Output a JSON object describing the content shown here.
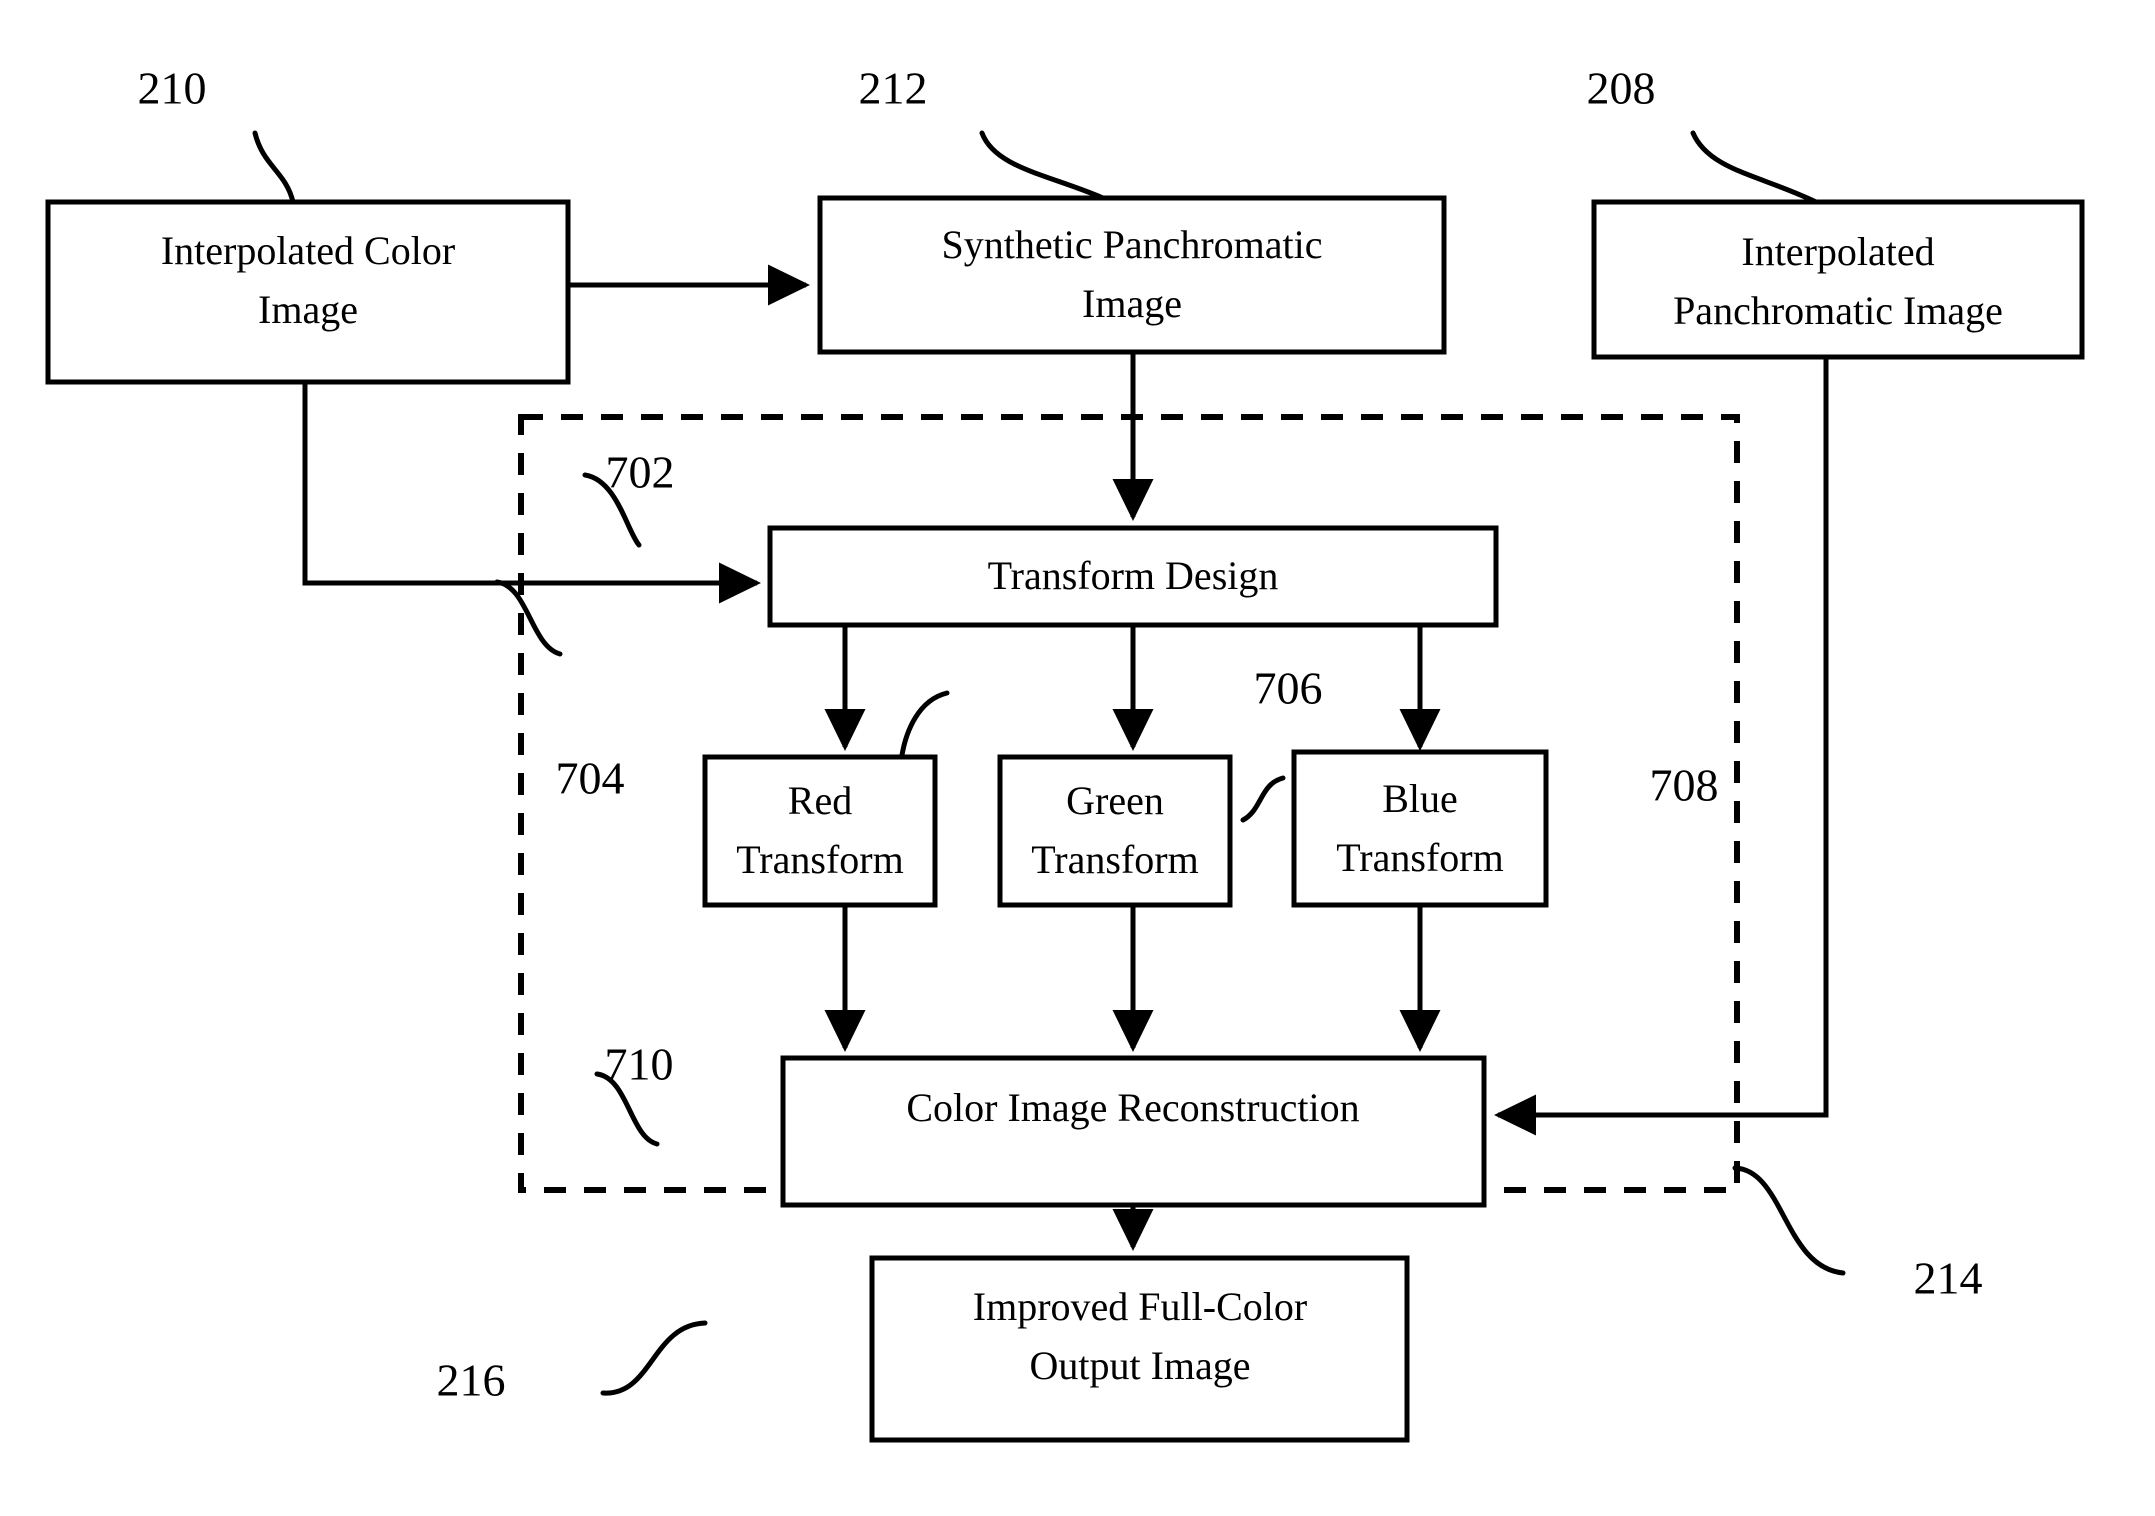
{
  "figure": {
    "type": "patent-block-diagram",
    "background_color": "#ffffff",
    "stroke_color": "#000000"
  },
  "nodes": {
    "interpolated_color_image": {
      "line1": "Interpolated Color",
      "line2": "Image",
      "ref": "210"
    },
    "synthetic_panchromatic_image": {
      "line1": "Synthetic Panchromatic",
      "line2": "Image",
      "ref": "212"
    },
    "interpolated_panchromatic_image": {
      "line1": "Interpolated",
      "line2": "Panchromatic Image",
      "ref": "208"
    },
    "transform_design": {
      "line1": "Transform Design",
      "ref": "702"
    },
    "red_transform": {
      "line1": "Red",
      "line2": "Transform",
      "ref": "704"
    },
    "green_transform": {
      "line1": "Green",
      "line2": "Transform",
      "ref": "706"
    },
    "blue_transform": {
      "line1": "Blue",
      "line2": "Transform",
      "ref": "708"
    },
    "color_image_reconstruction": {
      "line1": "Color Image Reconstruction",
      "ref": "710"
    },
    "improved_output_image": {
      "line1": "Improved Full-Color",
      "line2": "Output Image",
      "ref": "216"
    }
  },
  "regions": {
    "dashed_processing_block": {
      "ref": "214"
    }
  },
  "reference_numerals": {
    "r210": "210",
    "r212": "212",
    "r208": "208",
    "r702": "702",
    "r704": "704",
    "r706": "706",
    "r708": "708",
    "r710": "710",
    "r214": "214",
    "r216": "216"
  }
}
